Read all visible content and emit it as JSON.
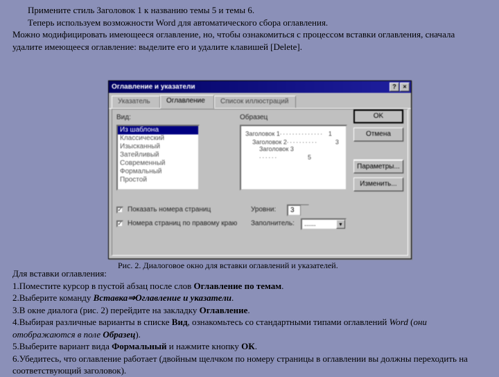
{
  "doc": {
    "p1": "Примените стиль Заголовок 1 к названию темы 5 и темы 6.",
    "p2": "Теперь используем возможности Word для автоматического сбора оглавления.",
    "p3": "Можно модифицировать имеющееся оглавление, но, чтобы ознакомиться с процессом вставки оглавления, сначала удалите имеющееся оглавление: выделите его и удалите клавишей [Delete].",
    "caption": "Рис. 2. Диалоговое окно для вставки оглавлений и указателей.",
    "b1": "Для вставки оглавления:",
    "b2a": "1.Поместите курсор в пустой абзац после слов ",
    "b2b": "Оглавление по темам",
    "b3a": "2.Выберите команду ",
    "b3b": "Вставка⇒Оглавление и указатели",
    "b4a": "3.В окне диалога (рис. 2) перейдите на закладку ",
    "b4b": "Оглавление",
    "b5a": "4.Выбирая различные варианты в списке ",
    "b5b": "Вид",
    "b5c": ", ознакомьтесь со стандартными типами оглавлений ",
    "b5d": "Word",
    "b5e": " (",
    "b5f": "они отображаются в поле ",
    "b5g": "Образец",
    "b5h": ").",
    "b6a": "5.Выберите вариант вида ",
    "b6b": "Формальный",
    "b6c": " и нажмите кнопку ",
    "b6d": "ОК",
    "b7": "6.Убедитесь, что оглавление работает (двойным щелчком по номеру страницы в оглавлении вы должны переходить на соответствующий заголовок)."
  },
  "dialog": {
    "title": "Оглавление и указатели",
    "help": "?",
    "close": "×",
    "tabs": {
      "t1": "Указатель",
      "t2": "Оглавление",
      "t3": "Список иллюстраций"
    },
    "vid_label": "Вид:",
    "obr_label": "Образец",
    "list": [
      "Из шаблона",
      "Классический",
      "Изысканный",
      "Затейливый",
      "Современный",
      "Формальный",
      "Простой"
    ],
    "preview": {
      "l1a": "Заголовок 1",
      "l1n": "1",
      "l2a": "Заголовок 2",
      "l2n": "3",
      "l3a": "Заголовок 3",
      "l3n": "5"
    },
    "btn_ok": "OK",
    "btn_cancel": "Отмена",
    "btn_nast": "Параметры...",
    "btn_izm": "Изменить...",
    "chk1": "Показать номера страниц",
    "chk2": "Номера страниц по правому краю",
    "urov": "Уровни:",
    "urov_val": "3",
    "zap": "Заполнитель:",
    "zap_val": "......",
    "check": "✓"
  }
}
